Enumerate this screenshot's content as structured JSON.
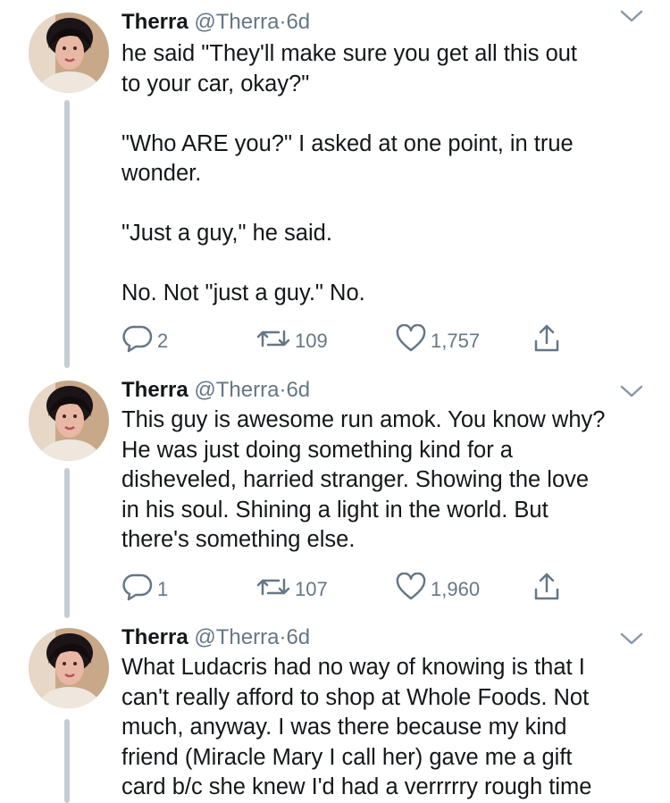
{
  "tweets": [
    {
      "name": "Therra",
      "handle": "@Therra",
      "dot": "·",
      "time": "6d",
      "text": "he said \"They'll make sure you get all this out\nto your car, okay?\"\n\n\"Who ARE you?\" I asked at one point, in true\nwonder.\n\n\"Just a guy,\" he said.\n\nNo. Not \"just a guy.\" No.",
      "replies": "2",
      "retweets": "109",
      "likes": "1,757"
    },
    {
      "name": "Therra",
      "handle": "@Therra",
      "dot": "·",
      "time": "6d",
      "text": "This guy is awesome run amok. You know why?\nHe was just doing something kind for a\ndisheveled, harried stranger. Showing the love\nin his soul. Shining a light in the world. But\nthere's something else.",
      "replies": "1",
      "retweets": "107",
      "likes": "1,960"
    },
    {
      "name": "Therra",
      "handle": "@Therra",
      "dot": "·",
      "time": "6d",
      "text": "What Ludacris had no way of knowing is that I\ncan't really afford to shop at Whole Foods. Not\nmuch, anyway. I was there because my kind\nfriend (Miracle Mary I call her) gave me a gift\ncard b/c she knew I'd had a verrrrry rough time"
    }
  ],
  "icons": {
    "reply": "reply-icon",
    "retweet": "retweet-icon",
    "like": "heart-icon",
    "share": "share-icon",
    "menu": "chevron-down-icon"
  },
  "colors": {
    "text": "#14171a",
    "secondary": "#657786",
    "thread_line": "#c4cdd3"
  }
}
